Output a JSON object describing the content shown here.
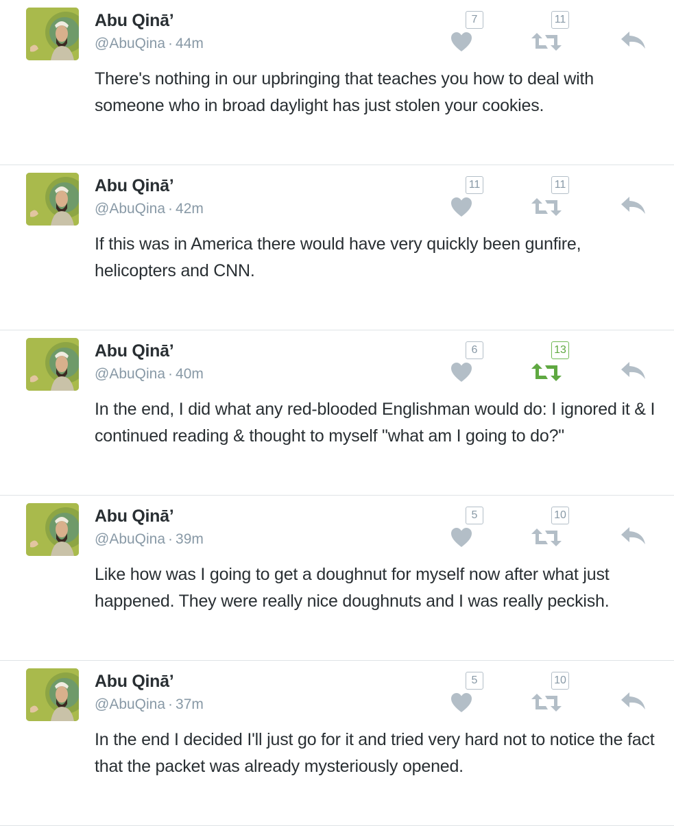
{
  "tweets": [
    {
      "name": "Abu Qinā’",
      "handle": "@AbuQina",
      "separator": "·",
      "time": "44m",
      "text": "There's nothing in our upbringing that teaches you how to deal with someone who in broad daylight has just stolen your cookies.",
      "likes": "7",
      "retweets": "11",
      "retweeted": false
    },
    {
      "name": "Abu Qinā’",
      "handle": "@AbuQina",
      "separator": "·",
      "time": "42m",
      "text": "If this was in America there would have very quickly been gunfire, helicopters and CNN.",
      "likes": "11",
      "retweets": "11",
      "retweeted": false
    },
    {
      "name": "Abu Qinā’",
      "handle": "@AbuQina",
      "separator": "·",
      "time": "40m",
      "text": "In the end, I did what any red-blooded Englishman would do: I ignored it & I continued reading & thought to myself \"what am I going to do?\"",
      "likes": "6",
      "retweets": "13",
      "retweeted": true
    },
    {
      "name": "Abu Qinā’",
      "handle": "@AbuQina",
      "separator": "·",
      "time": "39m",
      "text": "Like how was I going to get a doughnut for myself now after what just happened. They were really nice doughnuts and I was really peckish.",
      "likes": "5",
      "retweets": "10",
      "retweeted": false
    },
    {
      "name": "Abu Qinā’",
      "handle": "@AbuQina",
      "separator": "·",
      "time": "37m",
      "text": "In the end I decided I'll just go for it and tried very hard not to notice the fact that the packet was already mysteriously opened.",
      "likes": "5",
      "retweets": "10",
      "retweeted": false
    }
  ],
  "icons": {
    "like": "heart-icon",
    "retweet": "retweet-icon",
    "reply": "reply-icon"
  },
  "colors": {
    "icon_gray": "#b3bec7",
    "retweet_active": "#5fa841",
    "text": "#292f33",
    "meta": "#8899a6",
    "divider": "#dfe3e6"
  }
}
